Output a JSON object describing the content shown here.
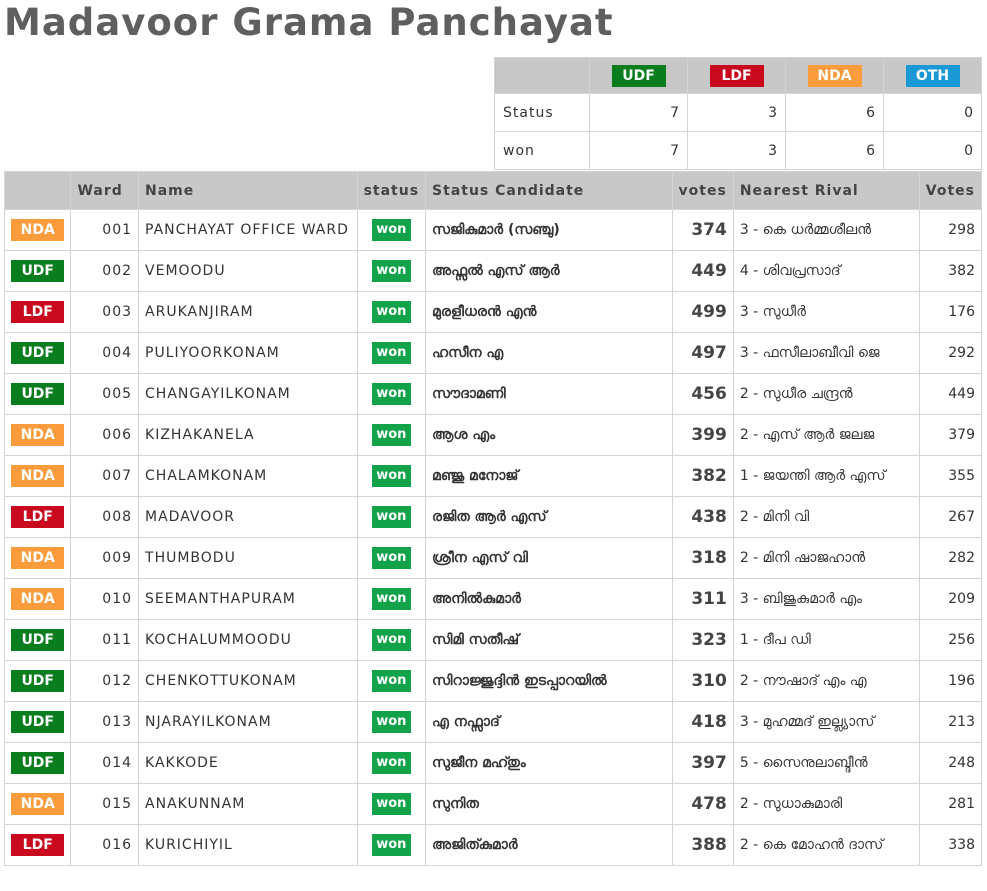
{
  "title": "Madavoor Grama Panchayat",
  "colors": {
    "UDF": "#0a7d1e",
    "LDF": "#c9091e",
    "NDA": "#fb9c3c",
    "OTH": "#1a98d5",
    "won": "#12a34a"
  },
  "summary": {
    "parties": [
      "UDF",
      "LDF",
      "NDA",
      "OTH"
    ],
    "rows": [
      {
        "label": "Status",
        "values": [
          "7",
          "3",
          "6",
          "0"
        ]
      },
      {
        "label": "won",
        "values": [
          "7",
          "3",
          "6",
          "0"
        ]
      }
    ]
  },
  "table": {
    "headers": {
      "ward": "Ward",
      "name": "Name",
      "status": "status",
      "candidate": "Status Candidate",
      "votes": "votes",
      "rival": "Nearest Rival",
      "rival_votes": "Votes"
    },
    "rows": [
      {
        "party": "NDA",
        "ward": "001",
        "name": "PANCHAYAT OFFICE WARD",
        "status": "won",
        "candidate": "സജികുമാർ (സഞ്ചു)",
        "votes": "374",
        "rival": "3 - കെ ധർമ്മശീലൻ",
        "rival_votes": "298"
      },
      {
        "party": "UDF",
        "ward": "002",
        "name": "VEMOODU",
        "status": "won",
        "candidate": "അഫ്സൽ എസ് ആർ",
        "votes": "449",
        "rival": "4 - ശിവപ്രസാദ്",
        "rival_votes": "382"
      },
      {
        "party": "LDF",
        "ward": "003",
        "name": "ARUKANJIRAM",
        "status": "won",
        "candidate": "മുരളീധരൻ എൻ",
        "votes": "499",
        "rival": "3 - സുധീർ",
        "rival_votes": "176"
      },
      {
        "party": "UDF",
        "ward": "004",
        "name": "PULIYOORKONAM",
        "status": "won",
        "candidate": "ഹസീന എ",
        "votes": "497",
        "rival": "3 - ഫസീലാബീവി ജെ",
        "rival_votes": "292"
      },
      {
        "party": "UDF",
        "ward": "005",
        "name": "CHANGAYILKONAM",
        "status": "won",
        "candidate": "സൗദാമണി",
        "votes": "456",
        "rival": "2 - സുധീര ചന്ദ്രൻ",
        "rival_votes": "449"
      },
      {
        "party": "NDA",
        "ward": "006",
        "name": "KIZHAKANELA",
        "status": "won",
        "candidate": "ആശ എം",
        "votes": "399",
        "rival": "2 - എസ് ആർ ജലജ",
        "rival_votes": "379"
      },
      {
        "party": "NDA",
        "ward": "007",
        "name": "CHALAMKONAM",
        "status": "won",
        "candidate": "മഞ്ജു മനോജ്",
        "votes": "382",
        "rival": "1 - ജയന്തി ആർ എസ്",
        "rival_votes": "355"
      },
      {
        "party": "LDF",
        "ward": "008",
        "name": "MADAVOOR",
        "status": "won",
        "candidate": "രജിത ആർ എസ്",
        "votes": "438",
        "rival": "2 - മിനി വി",
        "rival_votes": "267"
      },
      {
        "party": "NDA",
        "ward": "009",
        "name": "THUMBODU",
        "status": "won",
        "candidate": "ശ്രീന എസ് വി",
        "votes": "318",
        "rival": "2 - മിനി ഷാജഹാൻ",
        "rival_votes": "282"
      },
      {
        "party": "NDA",
        "ward": "010",
        "name": "SEEMANTHAPURAM",
        "status": "won",
        "candidate": "അനിൽകുമാർ",
        "votes": "311",
        "rival": "3 - ബിജുകുമാർ എം",
        "rival_votes": "209"
      },
      {
        "party": "UDF",
        "ward": "011",
        "name": "KOCHALUMMOODU",
        "status": "won",
        "candidate": "സിമി സതീഷ്",
        "votes": "323",
        "rival": "1 - ദീപ ഡി",
        "rival_votes": "256"
      },
      {
        "party": "UDF",
        "ward": "012",
        "name": "CHENKOTTUKONAM",
        "status": "won",
        "candidate": "സിറാജ്ജുദ്ദിൻ ഇടപ്പാറയിൽ",
        "votes": "310",
        "rival": "2 - നൗഷാദ് എം എ",
        "rival_votes": "196"
      },
      {
        "party": "UDF",
        "ward": "013",
        "name": "NJARAYILKONAM",
        "status": "won",
        "candidate": "എ നഫ്സാദ്",
        "votes": "418",
        "rival": "3 - മുഹമ്മദ് ഇല്ല്യാസ്",
        "rival_votes": "213"
      },
      {
        "party": "UDF",
        "ward": "014",
        "name": "KAKKODE",
        "status": "won",
        "candidate": "സുജീന മഹ്തും",
        "votes": "397",
        "rival": "5 - സൈനുലാബ്ദീൻ",
        "rival_votes": "248"
      },
      {
        "party": "NDA",
        "ward": "015",
        "name": "ANAKUNNAM",
        "status": "won",
        "candidate": "സുനിത",
        "votes": "478",
        "rival": "2 - സുധാകുമാരി",
        "rival_votes": "281"
      },
      {
        "party": "LDF",
        "ward": "016",
        "name": "KURICHIYIL",
        "status": "won",
        "candidate": "അജിത്കുമാർ",
        "votes": "388",
        "rival": "2 - കെ മോഹൻ ദാസ്",
        "rival_votes": "338"
      }
    ]
  }
}
